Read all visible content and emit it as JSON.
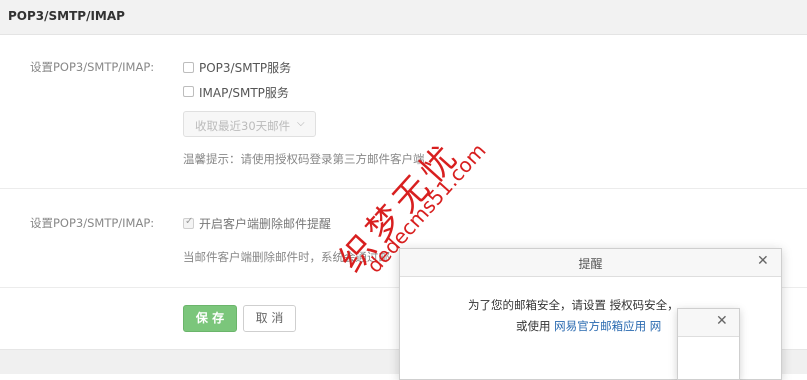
{
  "header": {
    "title": "POP3/SMTP/IMAP"
  },
  "section1": {
    "label": "设置POP3/SMTP/IMAP:",
    "options": [
      {
        "label": "POP3/SMTP服务",
        "checked": false
      },
      {
        "label": "IMAP/SMTP服务",
        "checked": false
      }
    ],
    "dropdown_value": "收取最近30天邮件",
    "tip": "温馨提示：请使用授权码登录第三方邮件客户端"
  },
  "section2": {
    "label": "设置POP3/SMTP/IMAP:",
    "option": {
      "label": "开启客户端删除邮件提醒",
      "checked": true
    },
    "tip": "当邮件客户端删除邮件时，系统会通过邮"
  },
  "actions": {
    "save_label": "保 存",
    "cancel_label": "取 消"
  },
  "dialog": {
    "title": "提醒",
    "message_line1": "为了您的邮箱安全，请设置 授权码安全，",
    "message_line2_prefix": "或使用 ",
    "message_line2_link": "网易官方邮箱应用",
    "message_line2_suffix": " 网"
  },
  "watermark": {
    "text_cn": "织梦无忧",
    "text_url": "dedecms51.com"
  },
  "icons": {
    "close": "close-icon",
    "chevron": "chevron-down-icon",
    "check": "check-icon"
  }
}
